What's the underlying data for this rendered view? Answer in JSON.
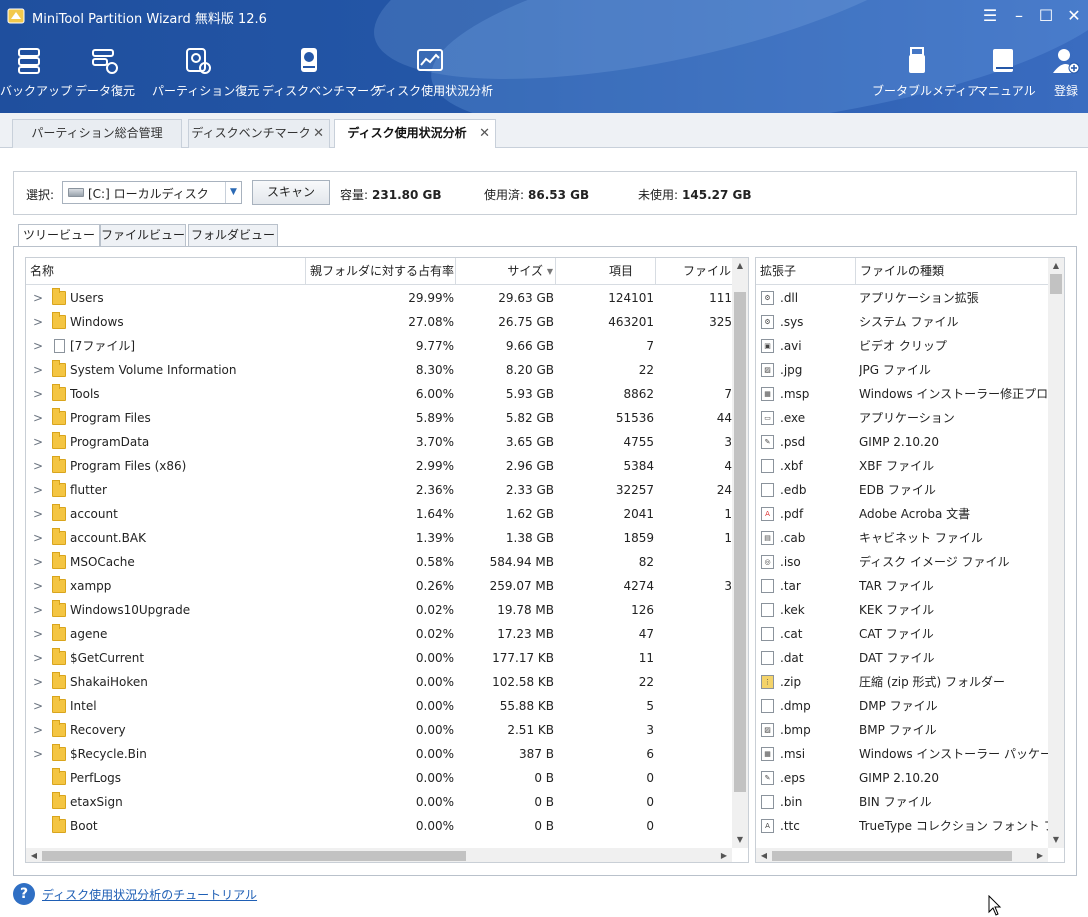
{
  "window": {
    "title": "MiniTool Partition Wizard 無料版 12.6",
    "controls": [
      "menu-icon",
      "minimize-icon",
      "maximize-icon",
      "close-icon"
    ]
  },
  "toolbar": {
    "backup": "バックアップ",
    "data_recovery": "データ復元",
    "partition_recovery": "パーティション復元",
    "disk_benchmark": "ディスクベンチマーク",
    "space_analyzer": "ディスク使用状況分析",
    "bootable_media": "ブータブルメディア",
    "manual": "マニュアル",
    "register": "登録"
  },
  "tabs": {
    "partition_mgmt": "パーティション総合管理",
    "benchmark": "ディスクベンチマーク",
    "analyzer": "ディスク使用状況分析"
  },
  "selection": {
    "label": "選択:",
    "drive": "[C:] ローカルディスク",
    "scan": "スキャン",
    "capacity_label": "容量:",
    "capacity": "231.80 GB",
    "used_label": "使用済:",
    "used": "86.53 GB",
    "free_label": "未使用:",
    "free": "145.27 GB"
  },
  "views": {
    "tree": "ツリービュー",
    "file": "ファイルビュー",
    "folder": "フォルダビュー"
  },
  "tree": {
    "headers": {
      "name": "名称",
      "percent": "親フォルダに対する占有率",
      "size": "サイズ",
      "items": "項目",
      "files": "ファイル"
    },
    "rows": [
      {
        "name": "Users",
        "pct": "29.99%",
        "size": "29.63 GB",
        "items": "124101",
        "files": "111",
        "type": "folder",
        "expand": true
      },
      {
        "name": "Windows",
        "pct": "27.08%",
        "size": "26.75 GB",
        "items": "463201",
        "files": "325",
        "type": "folder",
        "expand": true
      },
      {
        "name": "[7ファイル]",
        "pct": "9.77%",
        "size": "9.66 GB",
        "items": "7",
        "files": "",
        "type": "file",
        "expand": true
      },
      {
        "name": "System Volume Information",
        "pct": "8.30%",
        "size": "8.20 GB",
        "items": "22",
        "files": "",
        "type": "folder",
        "expand": true
      },
      {
        "name": "Tools",
        "pct": "6.00%",
        "size": "5.93 GB",
        "items": "8862",
        "files": "7",
        "type": "folder",
        "expand": true
      },
      {
        "name": "Program Files",
        "pct": "5.89%",
        "size": "5.82 GB",
        "items": "51536",
        "files": "44",
        "type": "folder",
        "expand": true
      },
      {
        "name": "ProgramData",
        "pct": "3.70%",
        "size": "3.65 GB",
        "items": "4755",
        "files": "3",
        "type": "folder",
        "expand": true
      },
      {
        "name": "Program Files (x86)",
        "pct": "2.99%",
        "size": "2.96 GB",
        "items": "5384",
        "files": "4",
        "type": "folder",
        "expand": true
      },
      {
        "name": "flutter",
        "pct": "2.36%",
        "size": "2.33 GB",
        "items": "32257",
        "files": "24",
        "type": "folder",
        "expand": true
      },
      {
        "name": "account",
        "pct": "1.64%",
        "size": "1.62 GB",
        "items": "2041",
        "files": "1",
        "type": "folder",
        "expand": true
      },
      {
        "name": "account.BAK",
        "pct": "1.39%",
        "size": "1.38 GB",
        "items": "1859",
        "files": "1",
        "type": "folder",
        "expand": true
      },
      {
        "name": "MSOCache",
        "pct": "0.58%",
        "size": "584.94 MB",
        "items": "82",
        "files": "",
        "type": "folder",
        "expand": true
      },
      {
        "name": "xampp",
        "pct": "0.26%",
        "size": "259.07 MB",
        "items": "4274",
        "files": "3",
        "type": "folder",
        "expand": true
      },
      {
        "name": "Windows10Upgrade",
        "pct": "0.02%",
        "size": "19.78 MB",
        "items": "126",
        "files": "",
        "type": "folder",
        "expand": true
      },
      {
        "name": "agene",
        "pct": "0.02%",
        "size": "17.23 MB",
        "items": "47",
        "files": "",
        "type": "folder",
        "expand": true
      },
      {
        "name": "$GetCurrent",
        "pct": "0.00%",
        "size": "177.17 KB",
        "items": "11",
        "files": "",
        "type": "folder",
        "expand": true
      },
      {
        "name": "ShakaiHoken",
        "pct": "0.00%",
        "size": "102.58 KB",
        "items": "22",
        "files": "",
        "type": "folder",
        "expand": true
      },
      {
        "name": "Intel",
        "pct": "0.00%",
        "size": "55.88 KB",
        "items": "5",
        "files": "",
        "type": "folder",
        "expand": true
      },
      {
        "name": "Recovery",
        "pct": "0.00%",
        "size": "2.51 KB",
        "items": "3",
        "files": "",
        "type": "folder",
        "expand": true
      },
      {
        "name": "$Recycle.Bin",
        "pct": "0.00%",
        "size": "387 B",
        "items": "6",
        "files": "",
        "type": "folder",
        "expand": true
      },
      {
        "name": "PerfLogs",
        "pct": "0.00%",
        "size": "0 B",
        "items": "0",
        "files": "",
        "type": "folder",
        "expand": false
      },
      {
        "name": "etaxSign",
        "pct": "0.00%",
        "size": "0 B",
        "items": "0",
        "files": "",
        "type": "folder",
        "expand": false
      },
      {
        "name": "Boot",
        "pct": "0.00%",
        "size": "0 B",
        "items": "0",
        "files": "",
        "type": "folder",
        "expand": false
      }
    ]
  },
  "ext": {
    "headers": {
      "ext": "拡張子",
      "type": "ファイルの種類"
    },
    "rows": [
      {
        "ext": ".dll",
        "type": "アプリケーション拡張",
        "icon": "gear-file-icon"
      },
      {
        "ext": ".sys",
        "type": "システム ファイル",
        "icon": "gear-file-icon"
      },
      {
        "ext": ".avi",
        "type": "ビデオ クリップ",
        "icon": "video-file-icon"
      },
      {
        "ext": ".jpg",
        "type": "JPG ファイル",
        "icon": "image-file-icon"
      },
      {
        "ext": ".msp",
        "type": "Windows インストーラー修正プログラム",
        "icon": "installer-icon"
      },
      {
        "ext": ".exe",
        "type": "アプリケーション",
        "icon": "app-icon"
      },
      {
        "ext": ".psd",
        "type": "GIMP 2.10.20",
        "icon": "gimp-icon"
      },
      {
        "ext": ".xbf",
        "type": "XBF ファイル",
        "icon": "file-icon"
      },
      {
        "ext": ".edb",
        "type": "EDB ファイル",
        "icon": "file-icon"
      },
      {
        "ext": ".pdf",
        "type": "Adobe Acroba 文書",
        "icon": "pdf-icon"
      },
      {
        "ext": ".cab",
        "type": "キャビネット ファイル",
        "icon": "cab-icon"
      },
      {
        "ext": ".iso",
        "type": "ディスク イメージ ファイル",
        "icon": "disc-icon"
      },
      {
        "ext": ".tar",
        "type": "TAR ファイル",
        "icon": "file-icon"
      },
      {
        "ext": ".kek",
        "type": "KEK ファイル",
        "icon": "file-icon"
      },
      {
        "ext": ".cat",
        "type": "CAT ファイル",
        "icon": "file-icon"
      },
      {
        "ext": ".dat",
        "type": "DAT ファイル",
        "icon": "file-icon"
      },
      {
        "ext": ".zip",
        "type": "圧縮 (zip 形式) フォルダー",
        "icon": "zip-icon"
      },
      {
        "ext": ".dmp",
        "type": "DMP ファイル",
        "icon": "file-icon"
      },
      {
        "ext": ".bmp",
        "type": "BMP ファイル",
        "icon": "image-file-icon"
      },
      {
        "ext": ".msi",
        "type": "Windows インストーラー パッケージ",
        "icon": "installer-icon"
      },
      {
        "ext": ".eps",
        "type": "GIMP 2.10.20",
        "icon": "gimp-icon"
      },
      {
        "ext": ".bin",
        "type": "BIN ファイル",
        "icon": "file-icon"
      },
      {
        "ext": ".ttc",
        "type": "TrueType コレクション フォント ファイル",
        "icon": "font-file-icon"
      }
    ]
  },
  "help": {
    "link": "ディスク使用状況分析のチュートリアル"
  },
  "colors": {
    "header": "#2457a8",
    "link": "#1f5fb5",
    "folder": "#f4c542"
  }
}
